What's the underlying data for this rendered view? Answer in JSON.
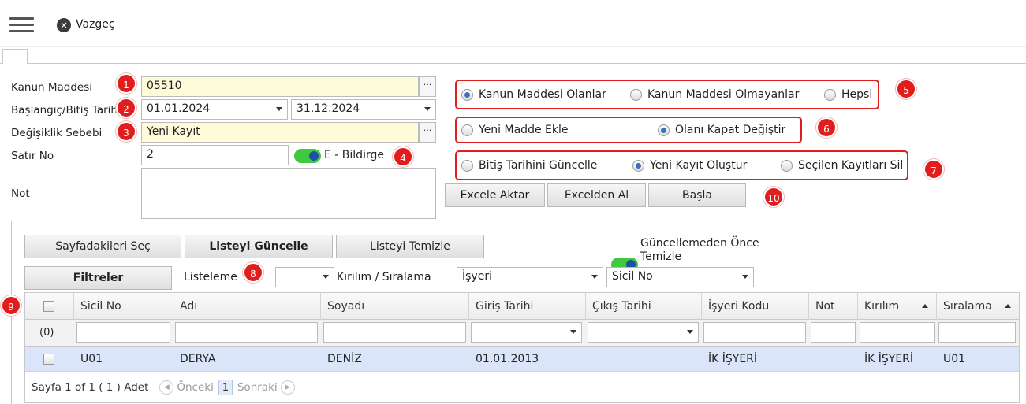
{
  "topbar": {
    "cancel_label": "Vazgeç",
    "close_icon": "×"
  },
  "form": {
    "kanun_maddesi": {
      "label": "Kanun Maddesi",
      "value": "05510",
      "badge": "1"
    },
    "tarih": {
      "label": "Başlangıç/Bitiş Tarihi",
      "start": "01.01.2024",
      "end": "31.12.2024",
      "badge": "2"
    },
    "degisiklik": {
      "label": "Değişiklik Sebebi",
      "value": "Yeni Kayıt",
      "badge": "3"
    },
    "satir_no": {
      "label": "Satır No",
      "value": "2"
    },
    "ebildirge": {
      "label": "E - Bildirge",
      "badge": "4",
      "on": true
    },
    "not": {
      "label": "Not",
      "value": ""
    },
    "dots": "···"
  },
  "group5": {
    "badge": "5",
    "options": [
      "Kanun Maddesi Olanlar",
      "Kanun Maddesi Olmayanlar",
      "Hepsi"
    ],
    "selected": 0
  },
  "group6": {
    "badge": "6",
    "options": [
      "Yeni Madde Ekle",
      "Olanı Kapat Değiştir"
    ],
    "selected": 1
  },
  "group7": {
    "badge": "7",
    "options": [
      "Bitiş Tarihini Güncelle",
      "Yeni Kayıt Oluştur",
      "Seçilen Kayıtları Sil"
    ],
    "selected": 1
  },
  "actions": {
    "excel_export": "Excele Aktar",
    "excel_import": "Excelden Al",
    "start": "Başla",
    "badge": "10"
  },
  "list": {
    "select_page": "Sayfadakileri Seç",
    "refresh": "Listeyi Güncelle",
    "clear": "Listeyi Temizle",
    "clear_before_update": "Güncellemeden Önce",
    "clear_before_update_2": "Temizle",
    "filters": "Filtreler",
    "listeleme_label": "Listeleme",
    "listeleme_value": "",
    "badge8": "8",
    "kirilim_label": "Kırılım / Sıralama",
    "kirilim_value": "İşyeri",
    "siralama_value": "Sicil No"
  },
  "grid": {
    "badge": "9",
    "columns": [
      "Sicil No",
      "Adı",
      "Soyadı",
      "Giriş Tarihi",
      "Çıkış Tarihi",
      "İşyeri Kodu",
      "Not",
      "Kırılım",
      "Sıralama"
    ],
    "count": "(0)",
    "rows": [
      {
        "sicil": "U01",
        "adi": "DERYA",
        "soyadi": "DENİZ",
        "giris": "01.01.2013",
        "cikis": "",
        "isyeri": "İK İŞYERİ",
        "not": "",
        "kirilim": "İK İŞYERİ",
        "siralama": "U01"
      }
    ],
    "pager": {
      "text": "Sayfa 1 of 1 ( 1 ) Adet",
      "prev": "Önceki",
      "page": "1",
      "next": "Sonraki"
    }
  },
  "colors": {
    "badge_red": "#e01e1e",
    "yellow_field": "#fdfbd8",
    "toggle_green": "#3ec93e",
    "row_selected": "#dbe5f9"
  }
}
